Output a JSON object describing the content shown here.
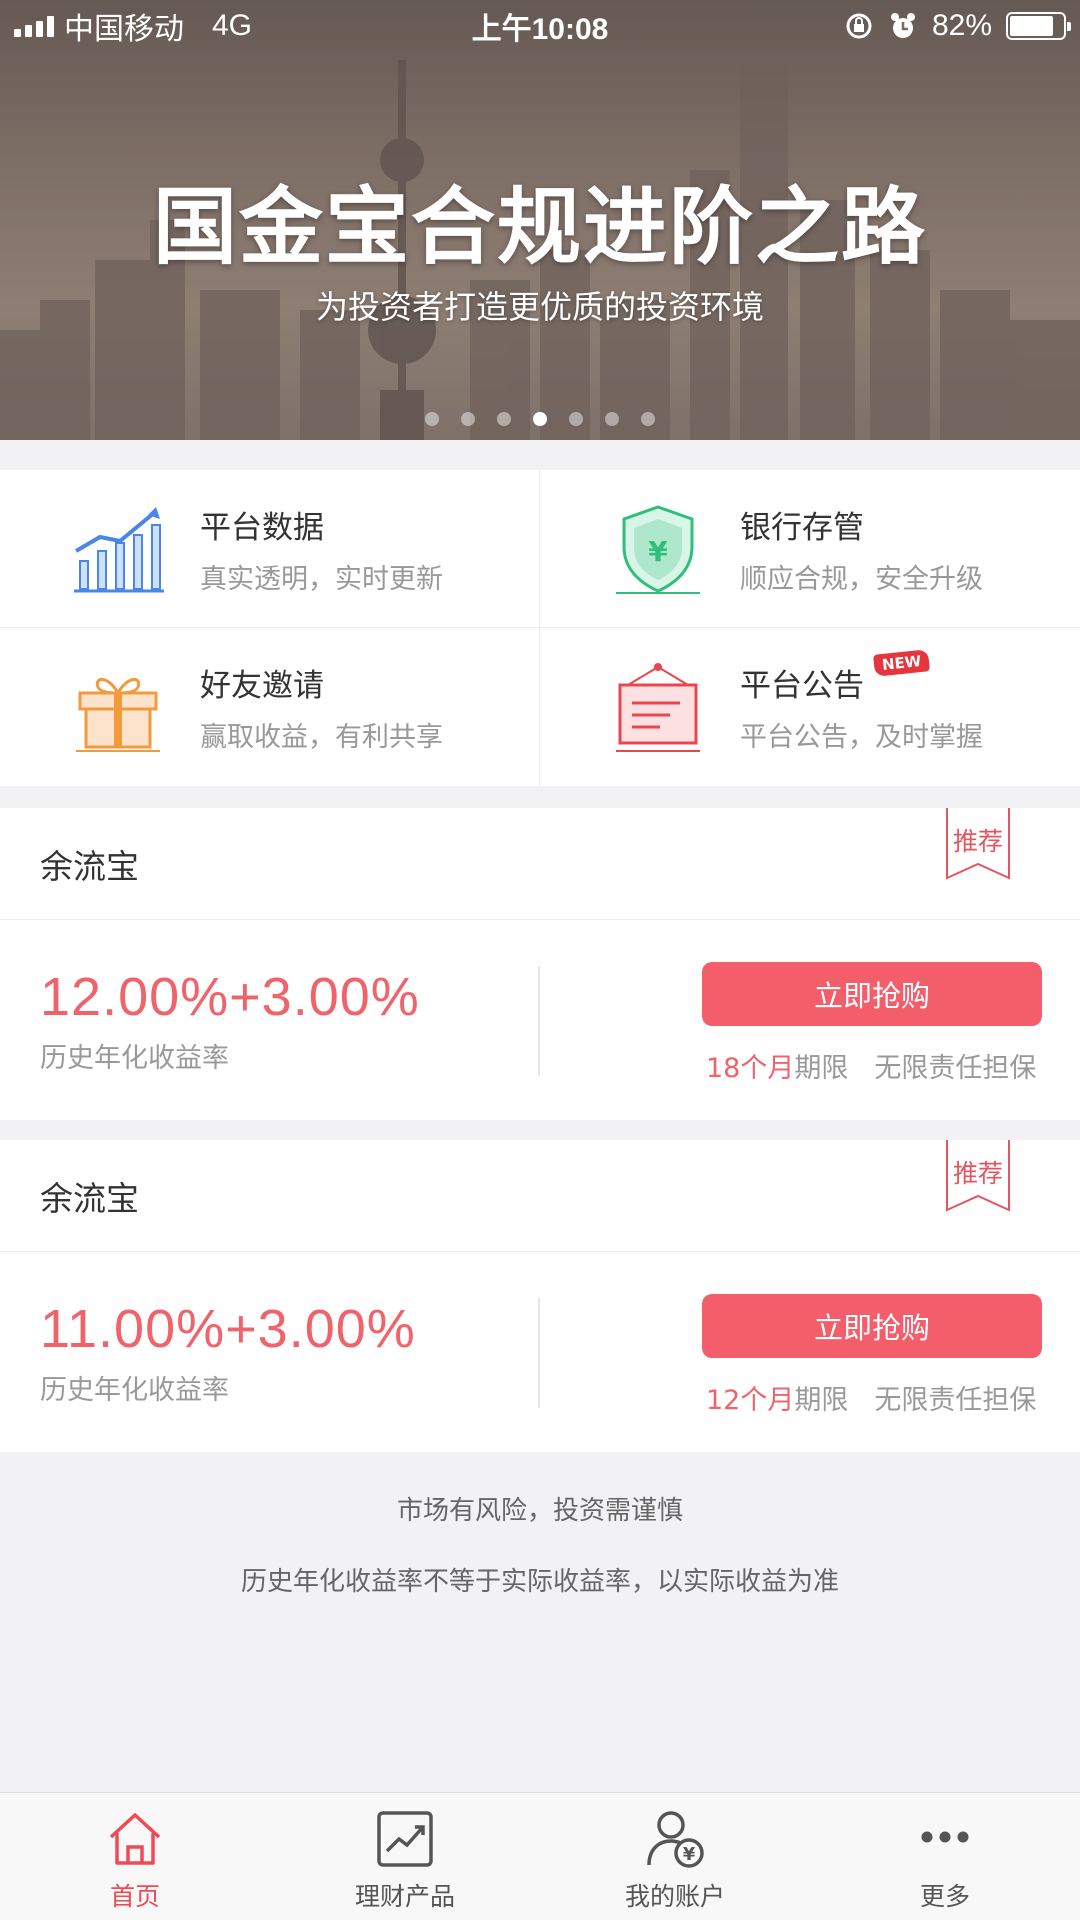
{
  "status_bar": {
    "carrier": "中国移动",
    "network": "4G",
    "time": "上午10:08",
    "battery_percent": "82%",
    "battery_level": 0.82
  },
  "banner": {
    "title": "国金宝合规进阶之路",
    "subtitle": "为投资者打造更优质的投资环境",
    "dots_total": 7,
    "active_dot": 3
  },
  "features": [
    {
      "title": "平台数据",
      "desc": "真实透明，实时更新",
      "icon": "chart-up-icon"
    },
    {
      "title": "银行存管",
      "desc": "顺应合规，安全升级",
      "icon": "shield-yen-icon"
    },
    {
      "title": "好友邀请",
      "desc": "赢取收益，有利共享",
      "icon": "gift-icon"
    },
    {
      "title": "平台公告",
      "desc": "平台公告，及时掌握",
      "icon": "notice-board-icon",
      "badge": "NEW"
    }
  ],
  "products": [
    {
      "name": "余流宝",
      "tag": "推荐",
      "rate": "12.00%+3.00%",
      "rate_label": "历史年化收益率",
      "button": "立即抢购",
      "term_num": "18个月",
      "term_suffix": "期限",
      "guarantee": "无限责任担保"
    },
    {
      "name": "余流宝",
      "tag": "推荐",
      "rate": "11.00%+3.00%",
      "rate_label": "历史年化收益率",
      "button": "立即抢购",
      "term_num": "12个月",
      "term_suffix": "期限",
      "guarantee": "无限责任担保"
    }
  ],
  "disclaimer": {
    "line1": "市场有风险，投资需谨慎",
    "line2": "历史年化收益率不等于实际收益率，以实际收益为准"
  },
  "tabbar": [
    {
      "label": "首页",
      "icon": "home-icon",
      "active": true
    },
    {
      "label": "理财产品",
      "icon": "chart-frame-icon",
      "active": false
    },
    {
      "label": "我的账户",
      "icon": "user-yen-icon",
      "active": false
    },
    {
      "label": "更多",
      "icon": "more-dots-icon",
      "active": false
    }
  ],
  "colors": {
    "accent": "#f35e6a",
    "rate_red": "#f0636b",
    "tab_active": "#ef4a55",
    "chart_blue": "#4a86e8",
    "shield_green": "#2fbf7a",
    "gift_orange": "#f39a3d",
    "notice_red": "#e8474f"
  }
}
